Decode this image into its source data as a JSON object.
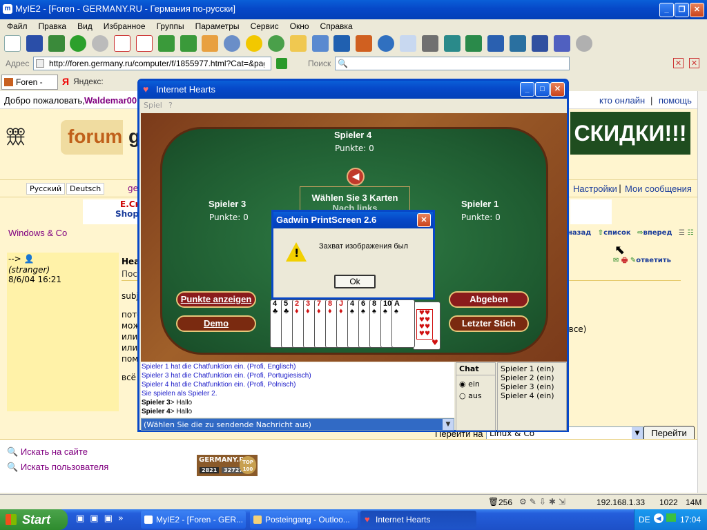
{
  "browser": {
    "title": "MyIE2 - [Foren - GERMANY.RU - Германия по-русски]",
    "menu": [
      "Файл",
      "Правка",
      "Вид",
      "Избранное",
      "Группы",
      "Параметры",
      "Сервис",
      "Окно",
      "Справка"
    ],
    "address_label": "Адрес",
    "address": "http://foren.germany.ru/computer/f/1855977.html?Cat=&pag",
    "search_label": "Поиск",
    "tabs": [
      "Foren - GE...",
      "Яндекс: хл..."
    ]
  },
  "page": {
    "welcome": "Добро пожаловать,",
    "username": "Waldemar00",
    "online": "кто онлайн",
    "help": "помощь",
    "logo_text": "forum",
    "logo_g": "g",
    "banner": "СКИДКИ!!!",
    "lang_ru": "Русский",
    "lang_de": "Deutsch",
    "lang_ge": "ge",
    "settings": "Настройки",
    "my_messages": "Мои сообщения",
    "promo1": "E.Ск",
    "promo2": "Shop",
    "forum_name": "Windows & Co",
    "nav_back": "назад",
    "nav_list": "список",
    "nav_next": "вперед",
    "arrow": "-->",
    "user_role": "(stranger)",
    "post_date": "8/6/04 16:21",
    "post_heading": "Hea",
    "post_sub": "Пос",
    "subj": "subj",
    "body_lines": [
      "пото",
      "мож",
      "или",
      "или",
      "пом"
    ],
    "body_last": "всё",
    "body_right": "рвсе)",
    "reply": "ответить",
    "goto_label": "Перейти на",
    "goto_select": "Linux & Co",
    "goto_button": "Перейти",
    "search_site": "Искать на сайте",
    "search_user": "Искать пользователя",
    "counter_logo": "GERMANY.RU",
    "counter_top": "TOP 100",
    "counter_a": "2821",
    "counter_b": "32727"
  },
  "hearts": {
    "title": "Internet Hearts",
    "menu": [
      "Spiel",
      "?"
    ],
    "p4_name": "Spieler 4",
    "p4_score": "Punkte: 0",
    "p3_name": "Spieler 3",
    "p3_score": "Punkte: 0",
    "p1_name": "Spieler 1",
    "p1_score": "Punkte: 0",
    "instruction": "Wählen Sie 3 Karten",
    "instruction2": "Nach links",
    "btn_points": "Punkte anzeigen",
    "btn_demo": "Demo",
    "btn_abgeben": "Abgeben",
    "btn_last": "Letzter Stich",
    "cards": [
      {
        "rank": "4",
        "suit": "♣",
        "color": "blk"
      },
      {
        "rank": "5",
        "suit": "♣",
        "color": "blk"
      },
      {
        "rank": "2",
        "suit": "♦",
        "color": "red"
      },
      {
        "rank": "3",
        "suit": "♦",
        "color": "red"
      },
      {
        "rank": "7",
        "suit": "♦",
        "color": "red"
      },
      {
        "rank": "8",
        "suit": "♦",
        "color": "red"
      },
      {
        "rank": "J",
        "suit": "♦",
        "color": "red"
      },
      {
        "rank": "4",
        "suit": "♠",
        "color": "blk"
      },
      {
        "rank": "6",
        "suit": "♠",
        "color": "blk"
      },
      {
        "rank": "8",
        "suit": "♠",
        "color": "blk"
      },
      {
        "rank": "10",
        "suit": "♠",
        "color": "blk"
      },
      {
        "rank": "A",
        "suit": "♠",
        "color": "blk"
      },
      {
        "rank": "10",
        "suit": "♥",
        "color": "red"
      }
    ],
    "chat_lines": [
      "Spieler 1 hat die Chatfunktion ein. (Profi, Englisch)",
      "Spieler 3 hat die Chatfunktion ein. (Profi, Portugiesisch)",
      "Spieler 4 hat die Chatfunktion ein. (Profi, Polnisch)",
      "Sie spielen als Spieler 2."
    ],
    "chat_msgs": [
      {
        "who": "Spieler 3",
        "text": "Hallo"
      },
      {
        "who": "Spieler 4",
        "text": "Hallo"
      }
    ],
    "chat_select": "(Wählen Sie die zu sendende Nachricht aus)",
    "chat_label": "Chat",
    "chat_on": "ein",
    "chat_off": "aus",
    "players": [
      "Spieler 1 (ein)",
      "Spieler 2 (ein)",
      "Spieler 3 (ein)",
      "Spieler 4 (ein)"
    ]
  },
  "dialog": {
    "title": "Gadwin PrintScreen 2.6",
    "message": "Захват изображения был",
    "ok": "Ok"
  },
  "status": {
    "count": "256",
    "ip": "192.168.1.33",
    "zoom": "1022",
    "mem": "14M"
  },
  "taskbar": {
    "start": "Start",
    "items": [
      "MyIE2 - [Foren - GER...",
      "Posteingang - Outloo...",
      "Internet Hearts"
    ],
    "lang": "DE",
    "time": "17:04"
  }
}
